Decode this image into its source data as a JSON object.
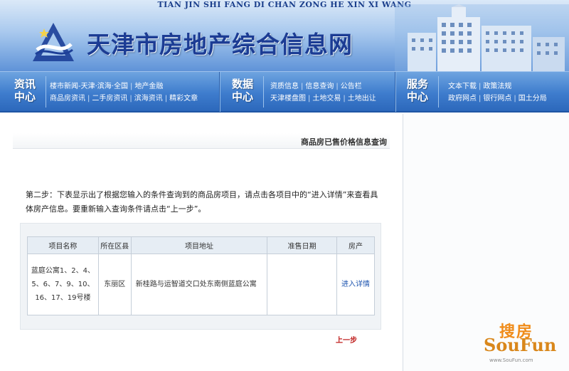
{
  "banner": {
    "pinyin": "TIAN JIN SHI FANG DI CHAN ZONG HE XIN XI WANG",
    "title": "天津市房地产综合信息网"
  },
  "nav": {
    "groups": [
      {
        "head": [
          "资讯",
          "中心"
        ],
        "rows": [
          [
            "楼市新闻-天津·滨海·全国",
            "地产金融"
          ],
          [
            "商品房资讯",
            "二手房资讯",
            "滨海资讯",
            "精彩文章"
          ]
        ]
      },
      {
        "head": [
          "数据",
          "中心"
        ],
        "rows": [
          [
            "资质信息",
            "信息查询",
            "公告栏"
          ],
          [
            "天津楼盘图",
            "土地交易",
            "土地出让"
          ]
        ]
      },
      {
        "head": [
          "服务",
          "中心"
        ],
        "rows": [
          [
            "文本下载",
            "政策法规"
          ],
          [
            "政府网点",
            "银行网点",
            "国土分局"
          ]
        ]
      }
    ]
  },
  "page": {
    "heading": "商品房已售价格信息查询",
    "intro": "第二步：下表显示出了根据您输入的条件查询到的商品房项目，请点击各项目中的“进入详情”来查看具体房产信息。要重新输入查询条件请点击“上一步”。",
    "prev_label": "上一步"
  },
  "table": {
    "headers": [
      "项目名称",
      "所在区县",
      "项目地址",
      "准售日期",
      "房产"
    ],
    "rows": [
      {
        "name": "蓝庭公寓1、2、4、5、6、7、9、10、16、17、19号楼",
        "district": "东丽区",
        "address": "新桂路与运智道交口处东南侧蓝庭公寓",
        "date": "",
        "action": "进入详情"
      }
    ]
  },
  "watermark": {
    "cn": "搜房",
    "en": "SouFun",
    "url": "www.SouFun.com"
  },
  "colors": {
    "nav_blue": "#3e7ccd",
    "title_blue": "#1c3c94",
    "link_blue": "#1f56b0",
    "prev_red": "#c0201f",
    "watermark_orange": "#f08c1a"
  }
}
